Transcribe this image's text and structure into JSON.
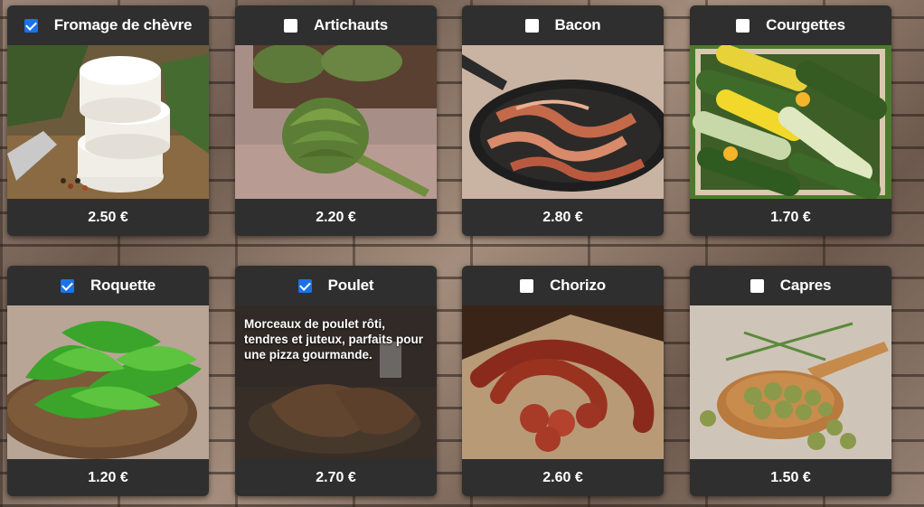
{
  "products": [
    {
      "name": "Fromage de chèvre",
      "price": "2.50 €",
      "checked": true,
      "icon": "goat-cheese-photo"
    },
    {
      "name": "Artichauts",
      "price": "2.20 €",
      "checked": false,
      "icon": "artichoke-photo"
    },
    {
      "name": "Bacon",
      "price": "2.80 €",
      "checked": false,
      "icon": "bacon-photo"
    },
    {
      "name": "Courgettes",
      "price": "1.70 €",
      "checked": false,
      "icon": "zucchini-photo"
    },
    {
      "name": "Roquette",
      "price": "1.20 €",
      "checked": true,
      "icon": "arugula-photo"
    },
    {
      "name": "Poulet",
      "price": "2.70 €",
      "checked": true,
      "icon": "chicken-photo",
      "description": "Morceaux de poulet rôti, tendres et juteux, parfaits pour une pizza gourmande."
    },
    {
      "name": "Chorizo",
      "price": "2.60 €",
      "checked": false,
      "icon": "chorizo-photo"
    },
    {
      "name": "Capres",
      "price": "1.50 €",
      "checked": false,
      "icon": "capers-photo"
    }
  ],
  "colors": {
    "card": "#2f2f2f",
    "checkbox_checked": "#1a73e8",
    "text": "#ffffff"
  }
}
